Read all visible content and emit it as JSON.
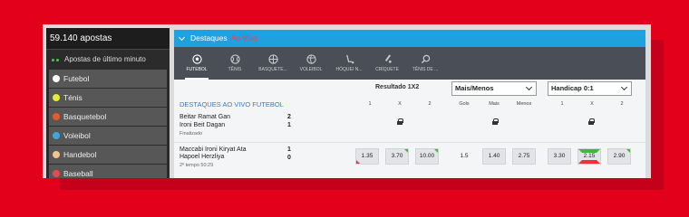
{
  "sidebar": {
    "header": "59.140 apostas",
    "live_label": "Apostas de último minuto",
    "items": [
      {
        "label": "Futebol",
        "icon": "soccer-ball-icon",
        "color": "#ffffff"
      },
      {
        "label": "Ténis",
        "icon": "tennis-ball-icon",
        "color": "#e6e83a"
      },
      {
        "label": "Basquetebol",
        "icon": "basketball-icon",
        "color": "#e85a2a"
      },
      {
        "label": "Voleibol",
        "icon": "volleyball-icon",
        "color": "#3fa7e0"
      },
      {
        "label": "Handebol",
        "icon": "handball-icon",
        "color": "#f2c48e"
      },
      {
        "label": "Baseball",
        "icon": "baseball-icon",
        "color": "#e84a4a"
      }
    ]
  },
  "topbar": {
    "title": "Destaques",
    "live": "Ao Vivo"
  },
  "tabs": [
    {
      "label": "FUTEBOL",
      "icon": "soccer-ball-icon",
      "active": true
    },
    {
      "label": "TÊNIS",
      "icon": "tennis-ball-icon",
      "active": false
    },
    {
      "label": "BASQUETE...",
      "icon": "basketball-icon",
      "active": false
    },
    {
      "label": "VOLEIBOL",
      "icon": "volleyball-icon",
      "active": false
    },
    {
      "label": "HÓQUEI N...",
      "icon": "hockey-icon",
      "active": false
    },
    {
      "label": "CRÍQUETE",
      "icon": "cricket-icon",
      "active": false
    },
    {
      "label": "TÊNIS DE ...",
      "icon": "table-tennis-icon",
      "active": false
    }
  ],
  "markets": {
    "result_title": "Resultado 1X2",
    "dropdown1": "Mais/Menos",
    "dropdown2": "Handicap 0:1",
    "section_title": "DESTAQUES AO VIVO FUTEBOL",
    "col_headers": [
      "1",
      "X",
      "2",
      "Gols",
      "Mais",
      "Menos",
      "1",
      "X",
      "2"
    ]
  },
  "matches": [
    {
      "home": "Beitar Ramat Gan",
      "away": "Ironi Beit Dagan",
      "home_score": "2",
      "away_score": "1",
      "status": "Finalizado",
      "locked": true
    },
    {
      "home": "Maccabi Ironi Kiryat Ata",
      "away": "Hapoel Herzliya",
      "home_score": "1",
      "away_score": "0",
      "status": "2º tempo 50:29",
      "locked": false,
      "odds_1x2": [
        "1.35",
        "3.70",
        "10.00"
      ],
      "goals": "1.5",
      "over_under": [
        "1.40",
        "2.75"
      ],
      "handicap": [
        "3.30",
        "2.15",
        "2.90"
      ]
    }
  ],
  "colors": {
    "brand_red": "#e3001b",
    "accent_blue": "#1fa1e0",
    "live_red": "#ff3c3c"
  }
}
